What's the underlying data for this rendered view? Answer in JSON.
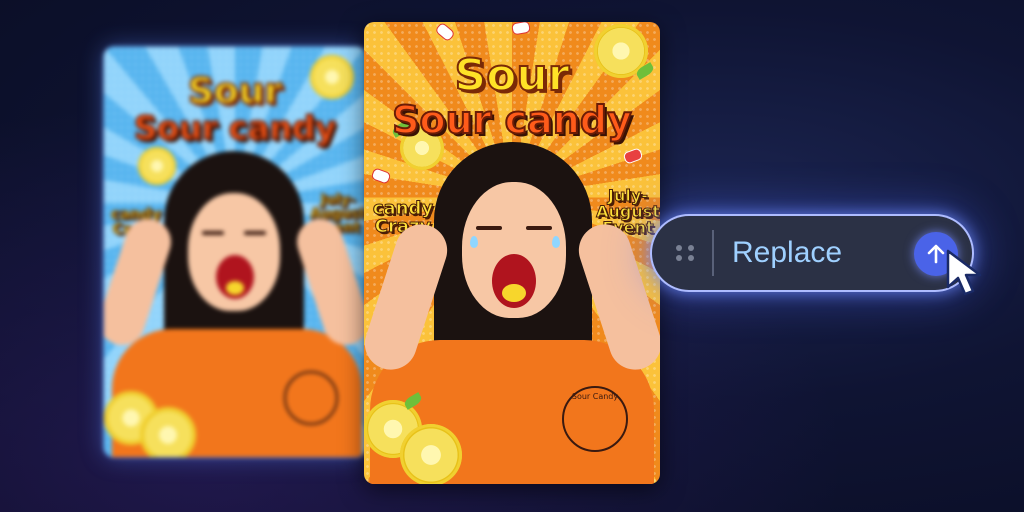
{
  "back_poster": {
    "title_line1": "Sour",
    "title_line2": "Sour candy",
    "left_text": "candy\nCrazy",
    "right_text": "July-\nAugust\nEvent"
  },
  "front_poster": {
    "title_line1": "Sour",
    "title_line2": "Sour candy",
    "left_text": "candy\nCrazy",
    "right_text": "July-\nAugust\nEvent",
    "stamp_text": "Sour Candy"
  },
  "replace_bar": {
    "label": "Replace",
    "handle_icon": "drag-handle-icon",
    "submit_icon": "arrow-up-icon"
  },
  "colors": {
    "background": "#0f1433",
    "pill_background": "#2b3145",
    "pill_glow": "#aebcff",
    "replace_text": "#9fd0ff",
    "submit_button": "#4a63e8"
  }
}
